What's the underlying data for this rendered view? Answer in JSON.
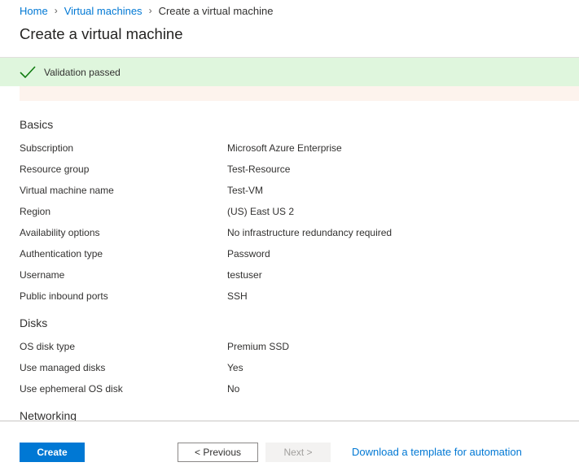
{
  "breadcrumb": {
    "items": [
      {
        "label": "Home"
      },
      {
        "label": "Virtual machines"
      },
      {
        "label": "Create a virtual machine"
      }
    ],
    "separator_icon": "chevron-right-icon"
  },
  "page": {
    "title": "Create a virtual machine"
  },
  "validation": {
    "text": "Validation passed",
    "icon": "checkmark-icon",
    "color": "#dff6dd",
    "icon_color": "#107c10"
  },
  "sections": {
    "basics": {
      "heading": "Basics",
      "rows": [
        {
          "label": "Subscription",
          "value": "Microsoft Azure Enterprise"
        },
        {
          "label": "Resource group",
          "value": "Test-Resource"
        },
        {
          "label": "Virtual machine name",
          "value": "Test-VM"
        },
        {
          "label": "Region",
          "value": "(US) East US 2"
        },
        {
          "label": "Availability options",
          "value": "No infrastructure redundancy required"
        },
        {
          "label": "Authentication type",
          "value": "Password"
        },
        {
          "label": "Username",
          "value": "testuser"
        },
        {
          "label": "Public inbound ports",
          "value": "SSH"
        }
      ]
    },
    "disks": {
      "heading": "Disks",
      "rows": [
        {
          "label": "OS disk type",
          "value": "Premium SSD"
        },
        {
          "label": "Use managed disks",
          "value": "Yes"
        },
        {
          "label": "Use ephemeral OS disk",
          "value": "No"
        }
      ]
    },
    "networking": {
      "heading": "Networking"
    }
  },
  "footer": {
    "create_label": "Create",
    "previous_label": "< Previous",
    "next_label": "Next >",
    "download_label": "Download a template for automation"
  },
  "colors": {
    "accent": "#0078d4",
    "success_bg": "#dff6dd",
    "warning_strip": "#fdf3ed"
  }
}
